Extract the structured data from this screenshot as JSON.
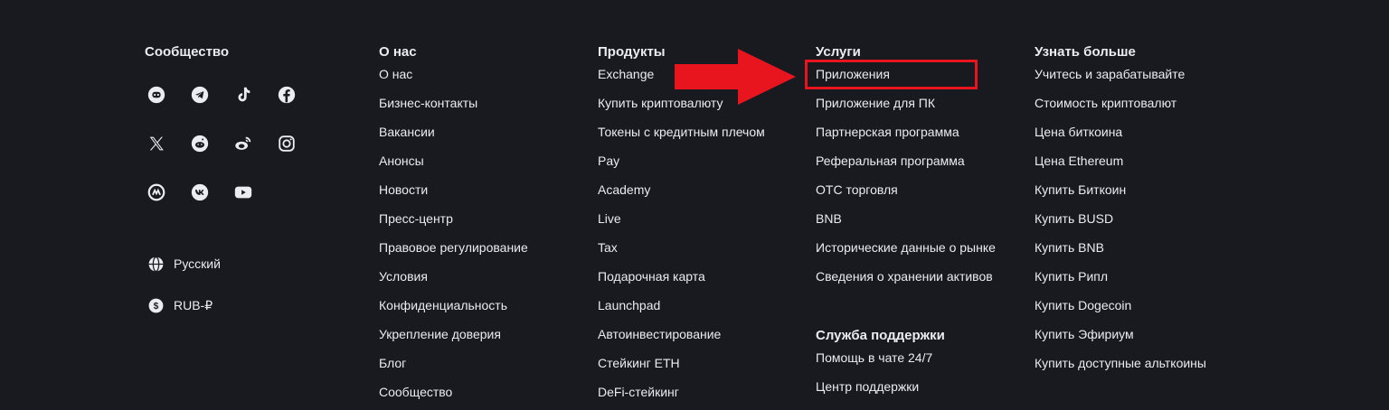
{
  "community": {
    "title": "Сообщество",
    "social_icons": [
      [
        "discord-icon",
        "telegram-icon",
        "tiktok-icon",
        "facebook-icon"
      ],
      [
        "x-icon",
        "reddit-icon",
        "weibo-icon",
        "instagram-icon"
      ],
      [
        "coinmarketcap-icon",
        "vk-icon",
        "youtube-icon"
      ]
    ],
    "language": "Русский",
    "currency": "RUB-₽"
  },
  "columns": [
    {
      "title": "О нас",
      "items": [
        "О нас",
        "Бизнес-контакты",
        "Вакансии",
        "Анонсы",
        "Новости",
        "Пресс-центр",
        "Правовое регулирование",
        "Условия",
        "Конфиденциальность",
        "Укрепление доверия",
        "Блог",
        "Сообщество"
      ]
    },
    {
      "title": "Продукты",
      "items": [
        "Exchange",
        "Купить криптовалюту",
        "Токены с кредитным плечом",
        "Pay",
        "Academy",
        "Live",
        "Tax",
        "Подарочная карта",
        "Launchpad",
        "Автоинвестирование",
        "Стейкинг ETH",
        "DeFi-стейкинг"
      ]
    },
    {
      "title": "Услуги",
      "items": [
        "Приложения",
        "Приложение для ПК",
        "Партнерская программа",
        "Реферальная программа",
        "OTC торговля",
        "BNB",
        "Исторические данные о рынке",
        "Сведения о хранении активов"
      ],
      "support_title": "Служба поддержки",
      "support_items": [
        "Помощь в чате 24/7",
        "Центр поддержки"
      ]
    },
    {
      "title": "Узнать больше",
      "items": [
        "Учитесь и зарабатывайте",
        "Стоимость криптовалют",
        "Цена биткоина",
        "Цена Ethereum",
        "Купить Биткоин",
        "Купить BUSD",
        "Купить BNB",
        "Купить Рипл",
        "Купить Dogecoin",
        "Купить Эфириум",
        "Купить доступные альткоины"
      ]
    }
  ],
  "annotation": {
    "arrow_color": "#e8141e",
    "highlight_color": "#e8141e"
  }
}
